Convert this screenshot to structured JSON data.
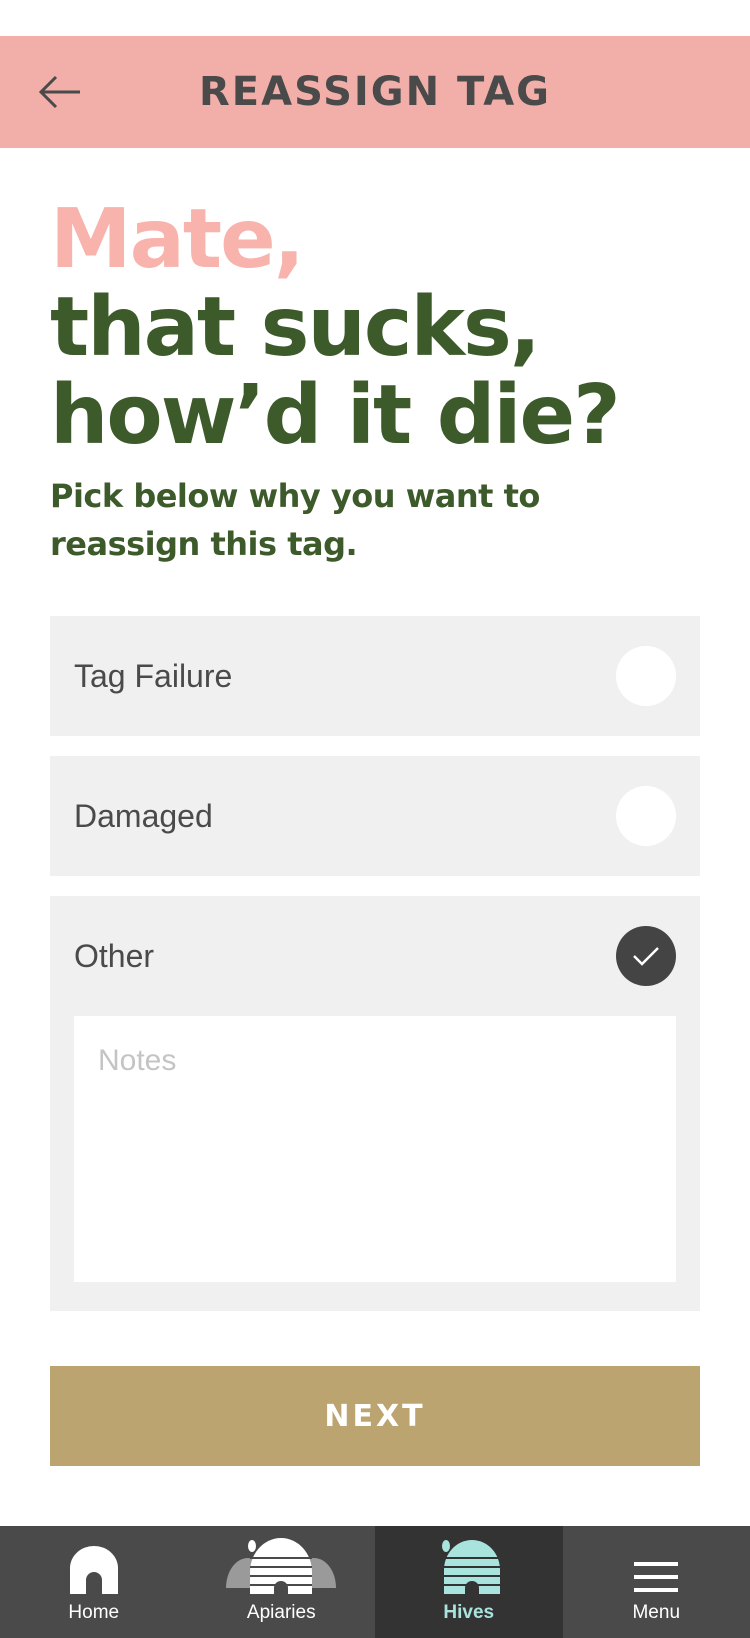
{
  "header": {
    "title": "REASSIGN TAG",
    "back_icon": "arrow-left-icon"
  },
  "headline": {
    "accent": "Mate,",
    "line1": "that sucks,",
    "line2": "how’d it die?"
  },
  "subtitle": "Pick below why you want to reassign this tag.",
  "options": [
    {
      "label": "Tag Failure",
      "checked": false
    },
    {
      "label": "Damaged",
      "checked": false
    },
    {
      "label": "Other",
      "checked": true
    }
  ],
  "notes": {
    "value": "",
    "placeholder": "Notes"
  },
  "next_button": {
    "label": "NEXT"
  },
  "bottom_nav": {
    "items": [
      {
        "label": "Home",
        "icon": "home-icon",
        "active": false
      },
      {
        "label": "Apiaries",
        "icon": "apiaries-icon",
        "active": false
      },
      {
        "label": "Hives",
        "icon": "hive-icon",
        "active": true
      },
      {
        "label": "Menu",
        "icon": "menu-icon",
        "active": false
      }
    ]
  },
  "colors": {
    "header_bg": "#f2aea8",
    "accent_pink": "#f8b3ac",
    "green": "#3d5a2b",
    "option_bg": "#f0f0f0",
    "button_gold": "#bca470",
    "nav_bg": "#4a4a4a",
    "nav_active": "#a8e3de"
  }
}
